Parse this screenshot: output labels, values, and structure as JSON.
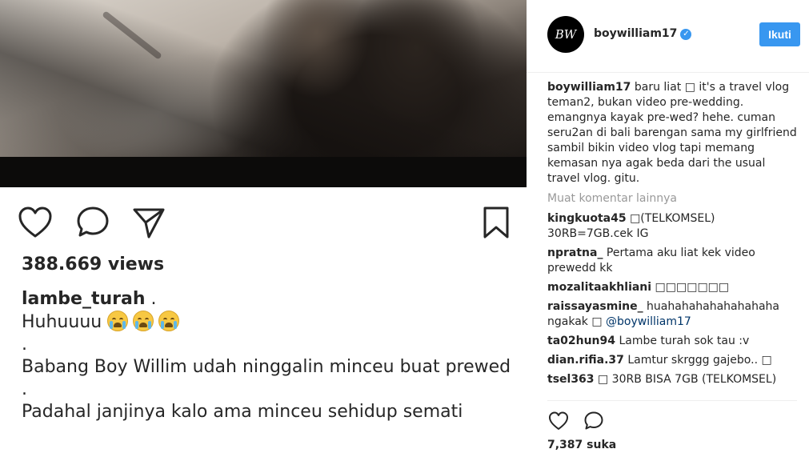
{
  "post": {
    "views": "388.669 views",
    "caption_user": "lambe_turah",
    "caption_after_user": " .",
    "caption_lines": [
      "Huhuuuu",
      ".",
      "Babang Boy Willim udah ninggalin minceu buat prewed",
      ".",
      "Padahal janjinya kalo ama minceu sehidup semati"
    ],
    "caption_emoji": [
      "loudly-crying-face",
      "loudly-crying-face",
      "loudly-crying-face"
    ]
  },
  "actions": {
    "like_icon": "heart-icon",
    "comment_icon": "comment-icon",
    "share_icon": "send-icon",
    "save_icon": "bookmark-icon"
  },
  "sidebar": {
    "avatar_text": "BW",
    "username": "boywilliam17",
    "verified_icon": "verified-badge-icon",
    "follow_label": "Ikuti",
    "load_more_label": "Muat komentar lainnya",
    "likes": "7,387 suka",
    "caption": {
      "user": "boywilliam17",
      "text": "baru liat □ it's a travel vlog teman2, bukan video pre-wedding. emangnya kayak pre-wed? hehe. cuman seru2an di bali barengan sama my girlfriend sambil bikin video vlog tapi memang kemasan nya agak beda dari the usual travel vlog. gitu."
    },
    "comments": [
      {
        "user": "kingkuota45",
        "text": "□(TELKOMSEL) 30RB=7GB.cek IG"
      },
      {
        "user": "npratna_",
        "text": "Pertama aku liat kek video prewedd kk"
      },
      {
        "user": "mozalitaakhliani",
        "text": "□□□□□□□"
      },
      {
        "user": "raissayasmine_",
        "text": "huahahahahahahahaha ngakak □",
        "mention": "@boywilliam17"
      },
      {
        "user": "ta02hun94",
        "text": "Lambe turah sok tau :v"
      },
      {
        "user": "dian.rifia.37",
        "text": "Lamtur skrggg gajebo.. □"
      },
      {
        "user": "tsel363",
        "text": "□ 30RB BISA 7GB (TELKOMSEL)"
      }
    ]
  },
  "colors": {
    "accent": "#3897f0",
    "text": "#262626",
    "muted": "#999999",
    "mention": "#003569"
  }
}
